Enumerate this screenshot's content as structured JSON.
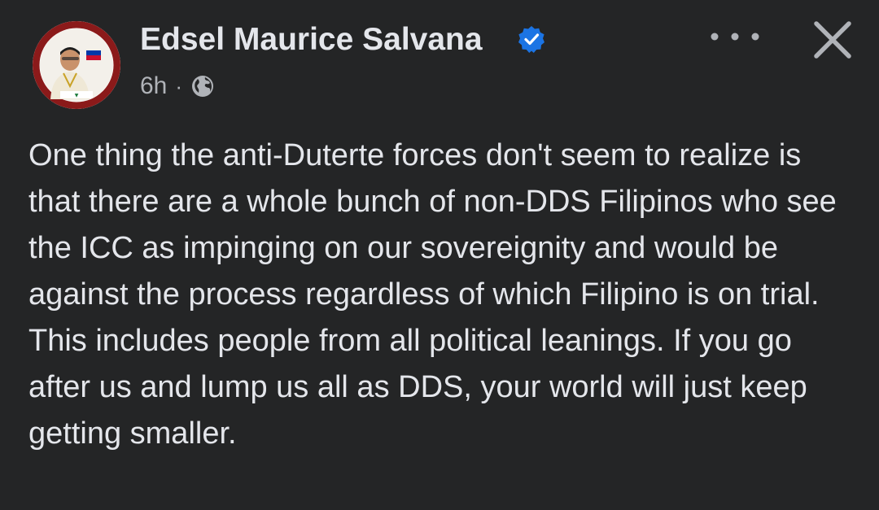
{
  "post": {
    "author_name": "Edsel Maurice Salvana",
    "timestamp": "6h",
    "separator": "·",
    "privacy_icon": "globe-icon",
    "verified_icon": "verified-badge-icon",
    "verified_color": "#1b74e4",
    "body": "One thing the anti-Duterte forces don't seem to realize is that there are a whole bunch of non-DDS Filipinos who see the ICC as impinging on our sovereignity and would be against the process regardless of which Filipino is on trial. This includes people from all political leanings. If you go after us and lump us all as DDS, your world will just keep getting smaller."
  },
  "header_actions": {
    "more_icon": "more-horizontal-icon",
    "close_icon": "close-icon"
  },
  "theme": {
    "background": "#242526",
    "primary_text": "#e4e6eb",
    "secondary_text": "#b0b3b8"
  }
}
